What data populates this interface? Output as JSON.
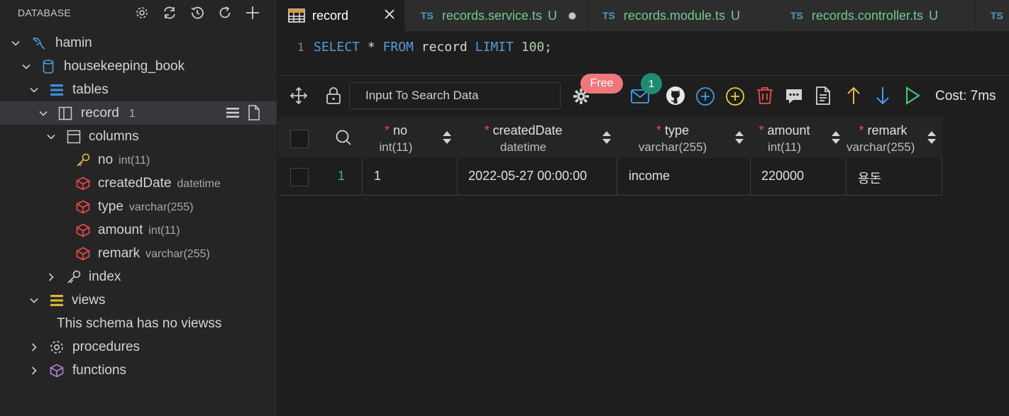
{
  "sidebar": {
    "title": "DATABASE",
    "tree": {
      "connection": "hamin",
      "database": "housekeeping_book",
      "tables": "tables",
      "table": {
        "label": "record",
        "count": "1"
      },
      "columns_folder": "columns",
      "columns": [
        {
          "name": "no",
          "type": "int(11)",
          "icon": "key-icon"
        },
        {
          "name": "createdDate",
          "type": "datetime",
          "icon": "cube-icon"
        },
        {
          "name": "type",
          "type": "varchar(255)",
          "icon": "cube-icon"
        },
        {
          "name": "amount",
          "type": "int(11)",
          "icon": "cube-icon"
        },
        {
          "name": "remark",
          "type": "varchar(255)",
          "icon": "cube-icon"
        }
      ],
      "index": "index",
      "views": "views",
      "views_empty": "This schema has no viewss",
      "procedures": "procedures",
      "functions": "functions"
    }
  },
  "tabs": [
    {
      "label": "record",
      "active": true
    },
    {
      "prefix": "TS",
      "label": "records.service.ts",
      "status": "U",
      "modified": true
    },
    {
      "prefix": "TS",
      "label": "records.module.ts",
      "status": "U"
    },
    {
      "prefix": "TS",
      "label": "records.controller.ts",
      "status": "U"
    },
    {
      "prefix": "TS"
    }
  ],
  "editor": {
    "line_number": "1",
    "query_parts": {
      "select": "SELECT",
      "star": " * ",
      "from": "FROM",
      "table": " record ",
      "limit": "LIMIT",
      "num": "100",
      "semi": ";"
    }
  },
  "toolbar": {
    "search_placeholder": "Input To Search Data",
    "free_badge": "Free",
    "mail_count": "1",
    "cost": "Cost: 7ms"
  },
  "grid": {
    "columns": [
      {
        "name": "no",
        "type": "int(11)"
      },
      {
        "name": "createdDate",
        "type": "datetime"
      },
      {
        "name": "type",
        "type": "varchar(255)"
      },
      {
        "name": "amount",
        "type": "int(11)"
      },
      {
        "name": "remark",
        "type": "varchar(255)"
      }
    ],
    "rows": [
      {
        "index": "1",
        "cells": [
          "1",
          "2022-05-27 00:00:00",
          "income",
          "220000",
          "용돈"
        ]
      }
    ]
  },
  "colors": {
    "accent_green": "#73c991",
    "required_red": "#f14c4c",
    "keyword_blue": "#569cd6",
    "badge_pink": "#f0787c",
    "badge_teal": "#1f8b74"
  }
}
